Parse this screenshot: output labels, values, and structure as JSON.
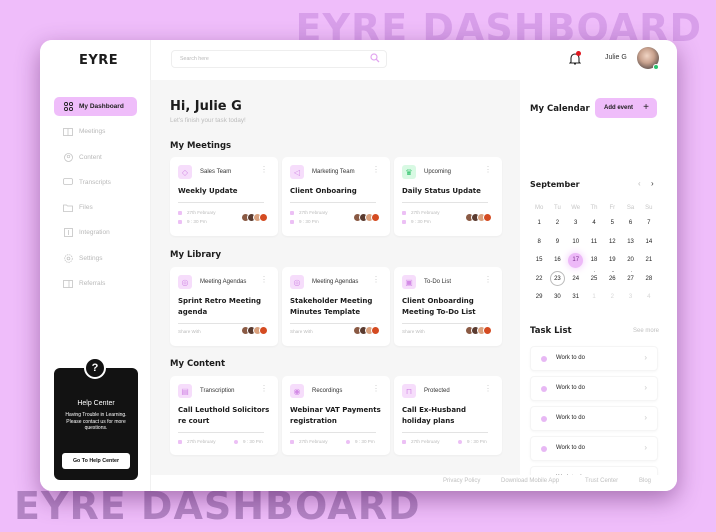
{
  "watermark": "EYRE DASHBOARD",
  "app": {
    "logo": "EYRE"
  },
  "colors": {
    "accent": "#efbdfa",
    "background": "#efbdfa",
    "dark": "#121212",
    "online": "#29c46d",
    "notification": "#e0161e"
  },
  "sidebar": {
    "items": [
      {
        "label": "My Dashboard",
        "icon": "grid-icon",
        "active": true
      },
      {
        "label": "Meetings",
        "icon": "book-icon"
      },
      {
        "label": "Content",
        "icon": "content-icon"
      },
      {
        "label": "Transcripts",
        "icon": "chat-icon"
      },
      {
        "label": "Files",
        "icon": "folder-icon"
      },
      {
        "label": "Integration",
        "icon": "integration-icon"
      },
      {
        "label": "Settings",
        "icon": "gear-icon"
      },
      {
        "label": "Referrals",
        "icon": "referral-icon"
      }
    ],
    "help": {
      "icon": "question-icon",
      "title": "Help Center",
      "text": "Having Trouble in Learning. Please contact us for more questions.",
      "button": "Go To Help Center"
    }
  },
  "topbar": {
    "search_placeholder": "Search here",
    "user_name": "Julie G"
  },
  "main": {
    "greeting": "Hi, Julie G",
    "subtitle": "Let's finish your task today!",
    "meetings": {
      "title": "My Meetings",
      "cards": [
        {
          "category": "Sales Team",
          "title": "Weekly Update",
          "date": "27th February",
          "time": "9 : 30 Pm",
          "icon": "tag-icon"
        },
        {
          "category": "Marketing Team",
          "title": "Client Onboaring",
          "date": "27th February",
          "time": "9 : 30 Pm",
          "icon": "megaphone-icon"
        },
        {
          "category": "Upcoming",
          "title": "Daily Status Update",
          "date": "27th February",
          "time": "9 : 30 Pm",
          "icon": "crown-icon"
        }
      ]
    },
    "library": {
      "title": "My Library",
      "cards": [
        {
          "category": "Meeting Agendas",
          "title": "Sprint Retro Meeting agenda",
          "share": "Share With",
          "icon": "target-icon"
        },
        {
          "category": "Meeting Agendas",
          "title": "Stakeholder Meeting Minutes Template",
          "share": "Share With",
          "icon": "target-icon"
        },
        {
          "category": "To-Do List",
          "title": "Client Onboarding Meeting To-Do List",
          "share": "Share With",
          "icon": "checklist-icon"
        }
      ]
    },
    "content": {
      "title": "My Content",
      "cards": [
        {
          "category": "Transcription",
          "title": "Call Leuthold Solicitors re court",
          "date": "27th February",
          "time": "9 : 30 Pm",
          "icon": "transcript-icon"
        },
        {
          "category": "Recordings",
          "title": "Webinar VAT Payments registration",
          "date": "27th February",
          "time": "9 : 30 Pm",
          "icon": "record-icon"
        },
        {
          "category": "Protected",
          "title": "Call Ex-Husband holiday plans",
          "date": "27th February",
          "time": "9 : 30 Pm",
          "icon": "lock-icon"
        }
      ]
    }
  },
  "calendar": {
    "title": "My Calendar",
    "add_event": "Add event",
    "month": "September",
    "weekdays": [
      "Mo",
      "Tu",
      "We",
      "Th",
      "Fr",
      "Sa",
      "Su"
    ],
    "days": [
      "1",
      "2",
      "3",
      "4",
      "5",
      "6",
      "7",
      "8",
      "9",
      "10",
      "11",
      "12",
      "13",
      "14",
      "15",
      "16",
      "17",
      "18",
      "19",
      "20",
      "21",
      "22",
      "23",
      "24",
      "25",
      "26",
      "27",
      "28",
      "29",
      "30",
      "31",
      "1",
      "2",
      "3",
      "4"
    ],
    "selected": "17",
    "today": "23",
    "event_days": [
      "25",
      "26",
      "27"
    ],
    "next_month_days_count": 4
  },
  "tasks": {
    "title": "Task List",
    "see_more": "See more",
    "items": [
      "Work to do",
      "Work to do",
      "Work to do",
      "Work to do",
      "Work to do"
    ]
  },
  "footer": {
    "links": [
      "Privacy Policy",
      "Download Mobile App",
      "Trust Center",
      "Blog"
    ]
  }
}
